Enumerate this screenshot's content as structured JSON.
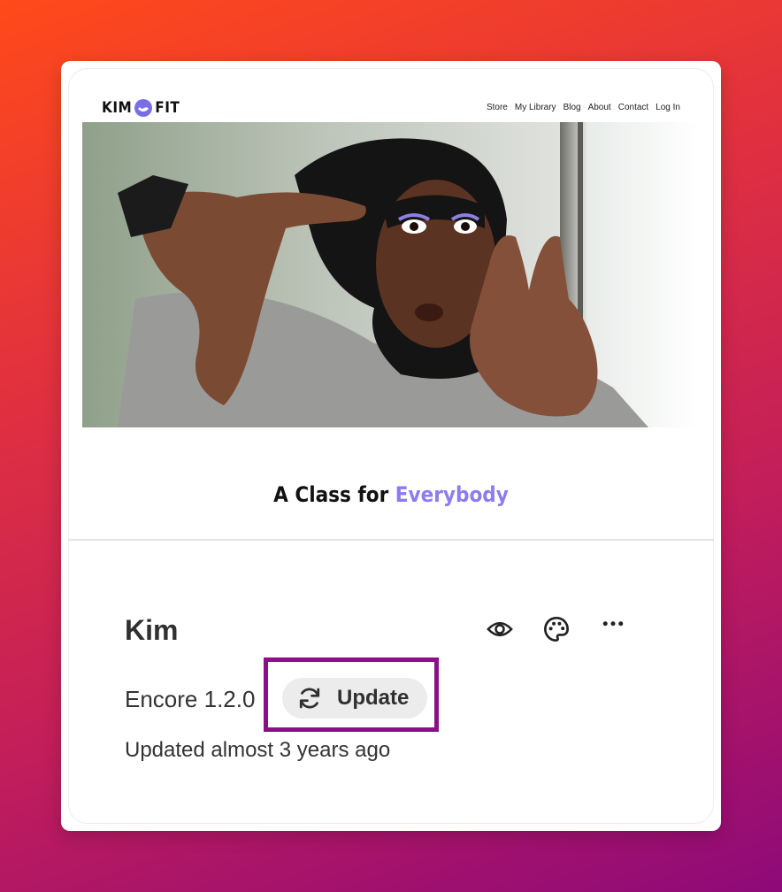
{
  "site": {
    "logo_left": "KIM",
    "logo_right": "FIT",
    "nav": [
      "Store",
      "My Library",
      "Blog",
      "About",
      "Contact",
      "Log In"
    ],
    "tagline_prefix": "A Class for ",
    "tagline_accent": "Everybody",
    "accent_color": "#8d7cf0"
  },
  "theme": {
    "name": "Kim",
    "version": "Encore 1.2.0",
    "update_label": "Update",
    "updated_text": "Updated almost 3 years ago"
  },
  "icons": {
    "preview": "eye-icon",
    "customize": "palette-icon",
    "more": "more-horizontal-icon",
    "update": "refresh-icon"
  },
  "colors": {
    "highlight": "#8b0f86",
    "button_bg": "#ececec"
  }
}
